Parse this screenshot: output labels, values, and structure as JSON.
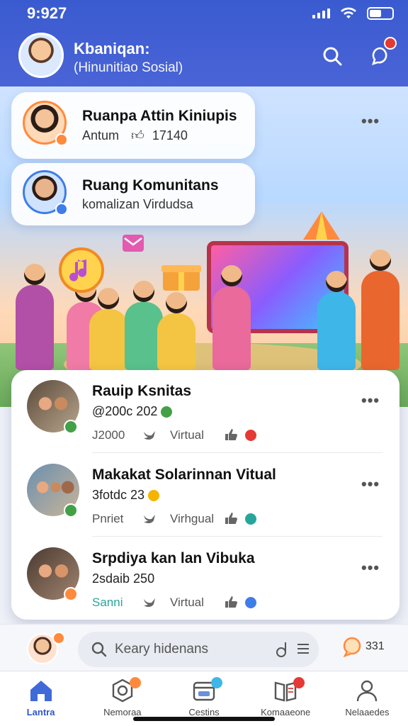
{
  "status": {
    "time": "9:927"
  },
  "header": {
    "title": "Kbaniqan:",
    "subtitle": "(Hinunitiao Sosial)"
  },
  "pinned": [
    {
      "title": "Ruanpa Attin Kiniupis",
      "sub": "Antum",
      "count": "17140"
    },
    {
      "title": "Ruang Komunitans",
      "sub": "komalizan Virdudsa"
    }
  ],
  "events": [
    {
      "title": "Rauip Ksnitas",
      "date": "@200c 202",
      "meta1": "J2000",
      "meta2": "Virtual",
      "badge_color": "#e53935"
    },
    {
      "title": "Makakat Solarinnan Vitual",
      "date": "3fotdc 23",
      "meta1": "Pnriet",
      "meta2": "Virhgual",
      "badge_color": "#26a69a"
    },
    {
      "title": "Srpdiya kan lan Vibuka",
      "date": "2sdaib 250",
      "meta1": "Sanni",
      "meta2": "Virtual",
      "badge_color": "#3f7de8"
    }
  ],
  "composer": {
    "placeholder": "Keary hidenans",
    "count": "331"
  },
  "nav": [
    {
      "label": "Lantra"
    },
    {
      "label": "Nemoraa"
    },
    {
      "label": "Cestins"
    },
    {
      "label": "Komaaeone"
    },
    {
      "label": "Nelaaedes"
    }
  ],
  "colors": {
    "primary": "#3a5bd0",
    "accent": "#ff8a3d"
  }
}
